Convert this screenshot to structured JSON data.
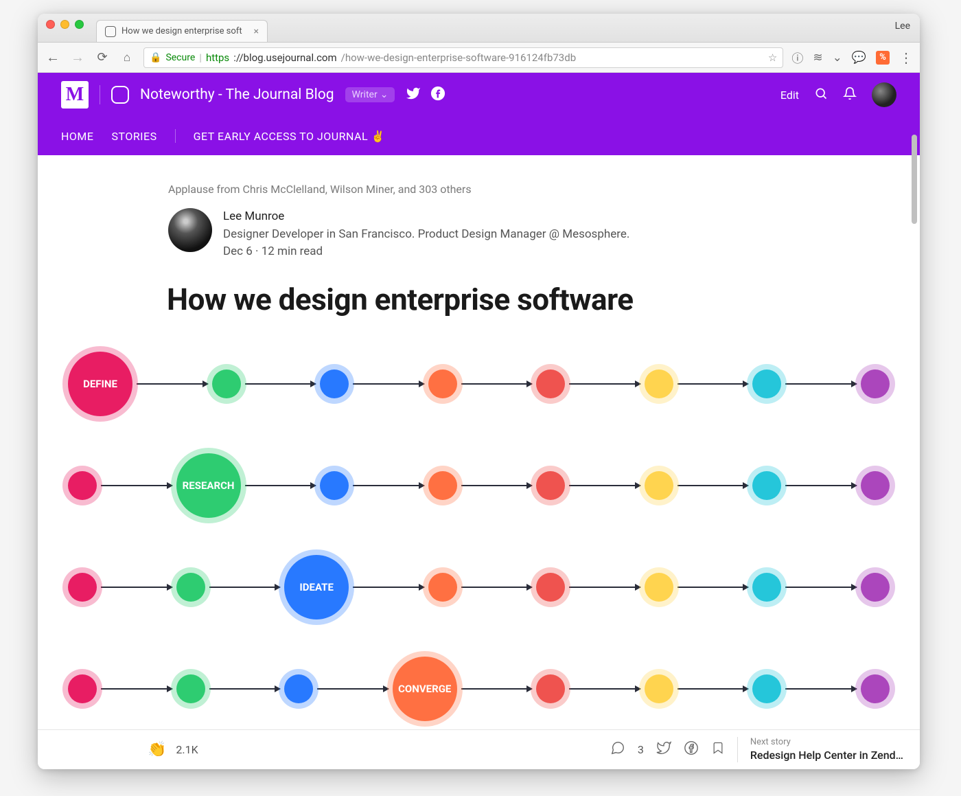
{
  "browser": {
    "profile_name": "Lee",
    "tab_title": "How we design enterprise soft",
    "secure_label": "Secure",
    "url_scheme": "https",
    "url_host": "://blog.usejournal.com",
    "url_path": "/how-we-design-enterprise-software-916124fb73db"
  },
  "header": {
    "logo_letter": "M",
    "blog_title": "Noteworthy - The Journal Blog",
    "writer_badge": "Writer",
    "edit_label": "Edit",
    "nav": {
      "home": "HOME",
      "stories": "STORIES",
      "early_access": "GET EARLY ACCESS TO JOURNAL ✌️"
    }
  },
  "article": {
    "applause": "Applause from Chris McClelland, Wilson Miner, and 303 others",
    "author_name": "Lee Munroe",
    "author_bio": "Designer Developer in San Francisco. Product Design Manager @ Mesosphere.",
    "date_read": "Dec 6 · 12 min read",
    "title": "How we design enterprise software"
  },
  "diagram": {
    "steps": [
      "DEFINE",
      "RESEARCH",
      "IDEATE",
      "CONVERGE"
    ],
    "colors": [
      "pink",
      "green",
      "blue",
      "orange",
      "red",
      "yellow",
      "cyan",
      "purple"
    ]
  },
  "footer": {
    "claps": "2.1K",
    "comments": "3",
    "next_label": "Next story",
    "next_title": "Redesign Help Center in Zend…"
  }
}
